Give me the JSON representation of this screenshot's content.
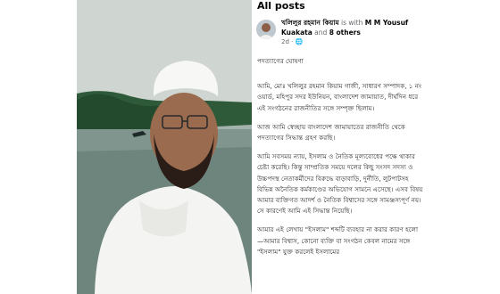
{
  "header": {
    "title": "All posts"
  },
  "post": {
    "author": "খলিলুর রহমান কিয়াম",
    "is_with": "is with",
    "tagged": "M M Yousuf Kuakata",
    "and_text": "and",
    "others": "8 others",
    "time": "2d",
    "dot": "·",
    "paragraphs": [
      "পদত্যাগের ঘোষণা",
      "আমি, মোঃ খলিলুর রহমান কিয়াম গাজী, সাধারণ সম্পাদক, ১ নং ওয়ার্ড, মহিপুর সদর ইউনিয়ন, বাংলাদেশ জামায়াত, দীর্ঘদিন ধরে এই সংগঠনের রাজনীতির সঙ্গে সম্পৃক্ত ছিলাম।",
      "আজ আমি স্বেচ্ছায় বাংলাদেশ জামায়াতের রাজনীতি থেকে পদত্যাগের সিদ্ধান্ত গ্রহণ করছি।",
      "আমি সবসময় ন্যায়, ইসলাম ও নৈতিক মূল্যবোধের পক্ষে থাকার চেষ্টা করেছি। কিন্তু সাম্প্রতিক সময়ে দলের কিছু সংসদ সদস্য ও উচ্চপদস্থ নেতাকর্মীদের বিরুদ্ধে বাড়াবাড়ি, দুর্নীতি, লুটপাটসহ বিভিন্ন অনৈতিক কর্মকাণ্ডের অভিযোগ সামনে এসেছে। এসব বিষয় আমার ব্যক্তিগত আদর্শ ও নৈতিক বিশ্বাসের সঙ্গে সামঞ্জস্যপূর্ণ নয়। সে কারণেই আমি এই সিদ্ধান্ত নিয়েছি।",
      "আমার এই লেখায় \"ইসলাম\" শব্দটি ব্যবহার না করার কারণ হলো—আমার বিশ্বাস, কোনো ব্যক্তি বা সংগঠন কেবল নামের সঙ্গে \"ইসলাম\" যুক্ত করলেই ইসলামের"
    ]
  }
}
